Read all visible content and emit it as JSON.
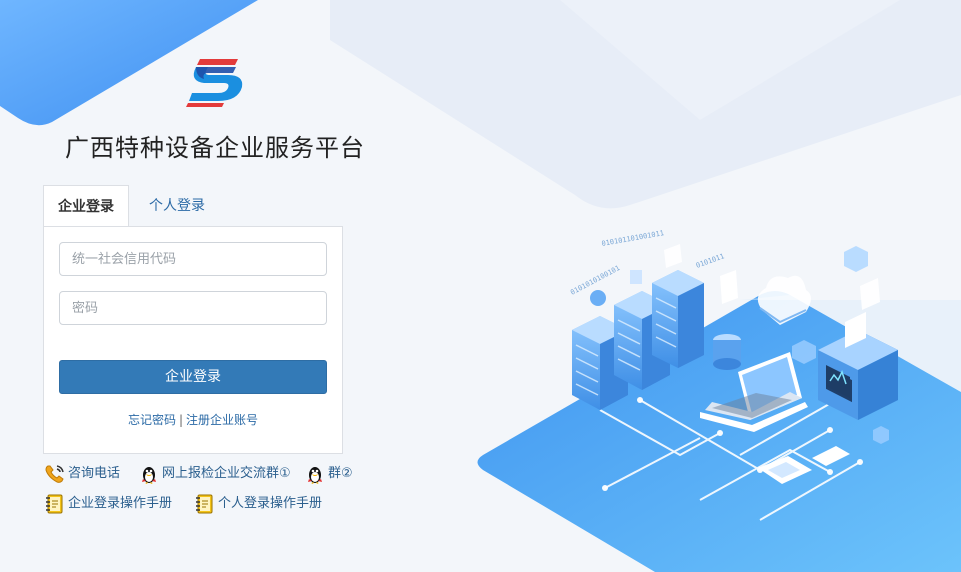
{
  "header": {
    "title": "广西特种设备企业服务平台"
  },
  "tabs": [
    {
      "label": "企业登录",
      "active": true
    },
    {
      "label": "个人登录",
      "active": false
    }
  ],
  "form": {
    "code_placeholder": "统一社会信用代码",
    "code_value": "",
    "password_placeholder": "密码",
    "password_value": "",
    "login_label": "企业登录"
  },
  "links": {
    "forgot": "忘记密码",
    "separator": "|",
    "register": "注册企业账号"
  },
  "contact": {
    "phone_label": "咨询电话",
    "qq_group1_label": "网上报检企业交流群①",
    "qq_group2_label": "群②"
  },
  "manuals": {
    "enterprise_label": "企业登录操作手册",
    "personal_label": "个人登录操作手册"
  },
  "colors": {
    "primary": "#337ab7",
    "link": "#2b6aa6",
    "accent_blue": "#5aa8f5"
  },
  "icons": {
    "logo": "s-logo-icon",
    "phone": "phone-icon",
    "qq": "qq-penguin-icon",
    "manual": "notebook-icon"
  }
}
